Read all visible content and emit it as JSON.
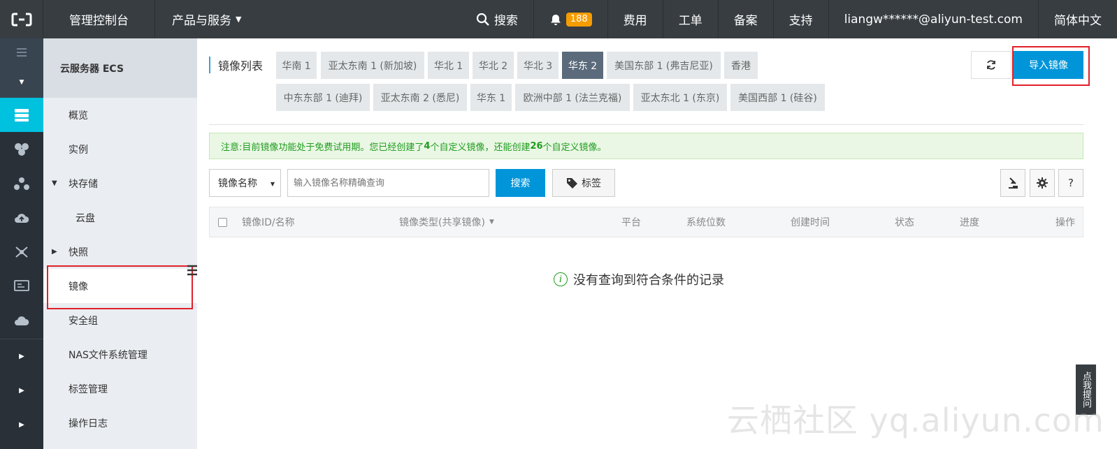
{
  "topbar": {
    "console_title": "管理控制台",
    "products": "产品与服务",
    "search": "搜索",
    "notification_count": "188",
    "billing": "费用",
    "tickets": "工单",
    "filing": "备案",
    "support": "支持",
    "account": "liangw******@aliyun-test.com",
    "language": "简体中文"
  },
  "sidemenu": {
    "title": "云服务器 ECS",
    "items": [
      {
        "label": "概览"
      },
      {
        "label": "实例"
      },
      {
        "label": "块存储"
      },
      {
        "label": "云盘"
      },
      {
        "label": "快照"
      },
      {
        "label": "镜像"
      },
      {
        "label": "安全组"
      },
      {
        "label": "NAS文件系统管理"
      },
      {
        "label": "标签管理"
      },
      {
        "label": "操作日志"
      }
    ]
  },
  "main": {
    "page_title": "镜像列表",
    "regions": [
      "华南 1",
      "亚太东南 1 (新加坡)",
      "华北 1",
      "华北 2",
      "华北 3",
      "华东 2",
      "美国东部 1 (弗吉尼亚)",
      "香港",
      "中东东部 1 (迪拜)",
      "亚太东南 2 (悉尼)",
      "华东 1",
      "欧洲中部 1 (法兰克福)",
      "亚太东北 1 (东京)",
      "美国西部 1 (硅谷)"
    ],
    "active_region": "华东 2",
    "import_button": "导入镜像",
    "notice": {
      "prefix": "注意:目前镜像功能处于免费试用期。您已经创建了",
      "created": "4",
      "middle": "个自定义镜像，还能创建",
      "remaining": "26",
      "suffix": "个自定义镜像。"
    },
    "search": {
      "field": "镜像名称",
      "placeholder": "输入镜像名称精确查询",
      "button": "搜索",
      "tag_button": "标签"
    },
    "table": {
      "columns": [
        "镜像ID/名称",
        "镜像类型(共享镜像)",
        "平台",
        "系统位数",
        "创建时间",
        "状态",
        "进度",
        "操作"
      ]
    },
    "empty_message": "没有查询到符合条件的记录"
  },
  "feedback": "点我提问",
  "watermark": "云栖社区 yq.aliyun.com",
  "colors": {
    "topbar_bg": "#373d41",
    "accent": "#00c1de",
    "primary_button": "#0095d9",
    "badge": "#f59c00",
    "highlight": "#e0212a"
  }
}
